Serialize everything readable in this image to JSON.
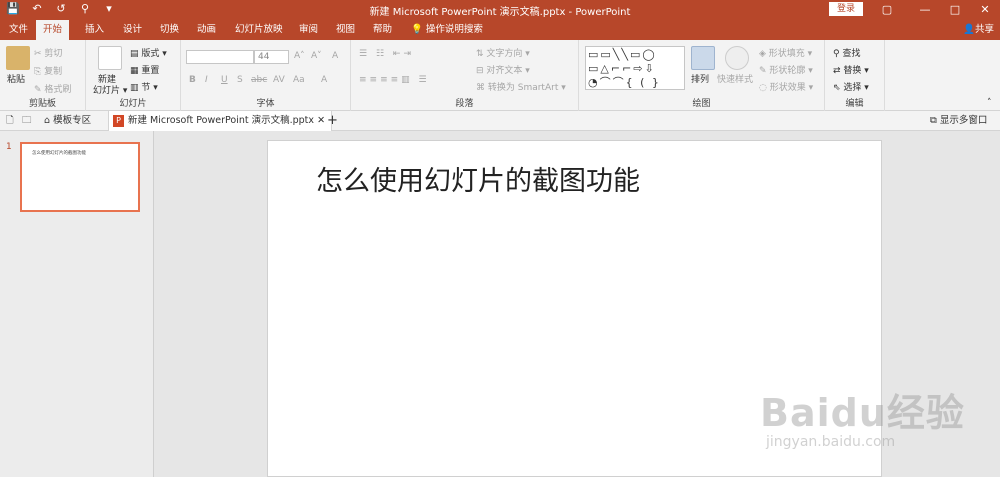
{
  "window": {
    "title": "新建 Microsoft PowerPoint 演示文稿.pptx  -  PowerPoint",
    "login_label": "登录",
    "controls": [
      "▢",
      "—",
      "□",
      "✕"
    ]
  },
  "qat": [
    "💾",
    "↶",
    "↺",
    "⚲",
    "▾"
  ],
  "ribbon_tabs": [
    "文件",
    "开始",
    "插入",
    "设计",
    "切换",
    "动画",
    "幻灯片放映",
    "审阅",
    "视图",
    "帮助",
    "操作说明搜索"
  ],
  "share_label": "共享",
  "clipboard": {
    "paste": "粘贴",
    "cut": "剪切",
    "copy": "复制",
    "format_painter": "格式刷",
    "label": "剪贴板"
  },
  "slides_group": {
    "new_slide": "新建",
    "new_slide2": "幻灯片",
    "layout": "版式",
    "reset": "重置",
    "section": "节",
    "label": "幻灯片"
  },
  "font_group": {
    "font_name": "",
    "font_size": "44",
    "grow": "A˄",
    "shrink": "A˅",
    "clear": "A",
    "bold": "B",
    "italic": "I",
    "underline": "U",
    "shadow": "S",
    "strike": "abc",
    "spacing": "AV",
    "case": "Aa",
    "color": "A",
    "label": "字体"
  },
  "paragraph_group": {
    "text_direction": "文字方向",
    "align_text": "对齐文本",
    "smartart": "转换为 SmartArt",
    "label": "段落"
  },
  "drawing_group": {
    "arrange": "排列",
    "quick_styles": "快速样式",
    "shape_fill": "形状填充",
    "shape_outline": "形状轮廓",
    "shape_effects": "形状效果",
    "label": "绘图"
  },
  "editing_group": {
    "find": "查找",
    "replace": "替换",
    "select": "选择",
    "label": "编辑"
  },
  "docbar": {
    "template_zone": "模板专区",
    "doc_tab": "新建 Microsoft PowerPoint 演示文稿.pptx",
    "close": "✕",
    "add": "+",
    "multi_window": "显示多窗口"
  },
  "thumbnail": {
    "number": "1",
    "text": "怎么使用幻灯片的截图功能"
  },
  "slide": {
    "title": "怎么使用幻灯片的截图功能"
  },
  "watermark": {
    "brand": "Baidu经验",
    "url": "jingyan.baidu.com"
  }
}
